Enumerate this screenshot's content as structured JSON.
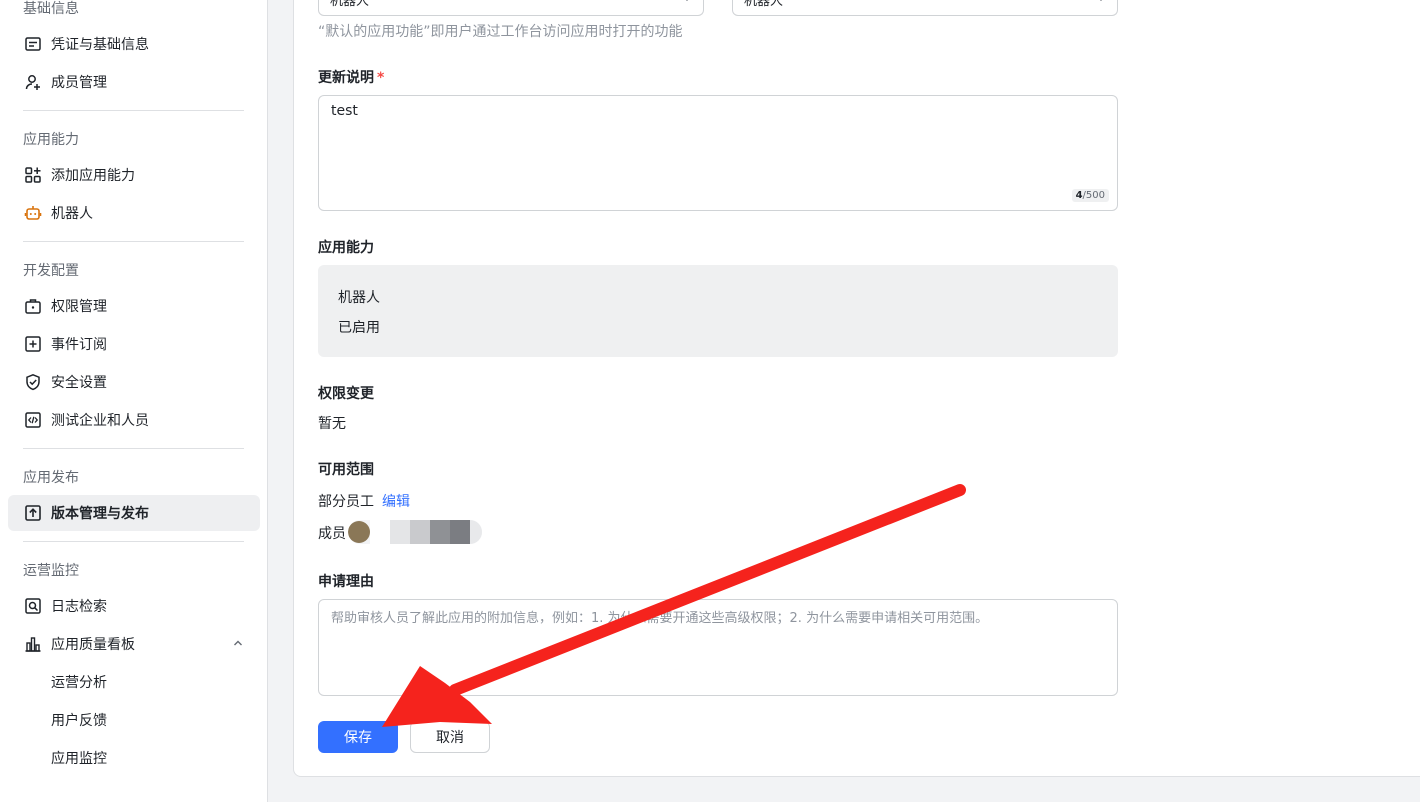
{
  "sidebar": {
    "sections": [
      {
        "title": "基础信息"
      },
      {
        "title": "应用能力"
      },
      {
        "title": "开发配置"
      },
      {
        "title": "应用发布"
      },
      {
        "title": "运营监控"
      }
    ],
    "items": {
      "credentials": "凭证与基础信息",
      "members": "成员管理",
      "add_capability": "添加应用能力",
      "bot": "机器人",
      "permissions": "权限管理",
      "events": "事件订阅",
      "security": "安全设置",
      "test_org": "测试企业和人员",
      "version_release": "版本管理与发布",
      "log_search": "日志检索",
      "quality_board": "应用质量看板",
      "ops_analysis": "运营分析",
      "user_feedback": "用户反馈",
      "app_monitor": "应用监控"
    }
  },
  "form": {
    "select_left_value": "机器人",
    "select_right_value": "机器人",
    "default_func_hint": "“默认的应用功能”即用户通过工作台访问应用时打开的功能",
    "update_notes_label": "更新说明",
    "required_mark": "*",
    "update_notes_value": "test",
    "counter_current": "4",
    "counter_max": "/500",
    "capability_label": "应用能力",
    "capability_name": "机器人",
    "capability_status": "已启用",
    "permission_change_label": "权限变更",
    "permission_change_value": "暂无",
    "scope_label": "可用范围",
    "scope_value": "部分员工",
    "scope_edit": "编辑",
    "members_label": "成员",
    "reason_label": "申请理由",
    "reason_placeholder": "帮助审核人员了解此应用的附加信息，例如：1. 为什么需要开通这些高级权限；2. 为什么需要申请相关可用范围。",
    "save_button": "保存",
    "cancel_button": "取消"
  },
  "colors": {
    "primary": "#3370ff",
    "annotation_arrow": "#f5231d",
    "required": "#f54a45"
  }
}
